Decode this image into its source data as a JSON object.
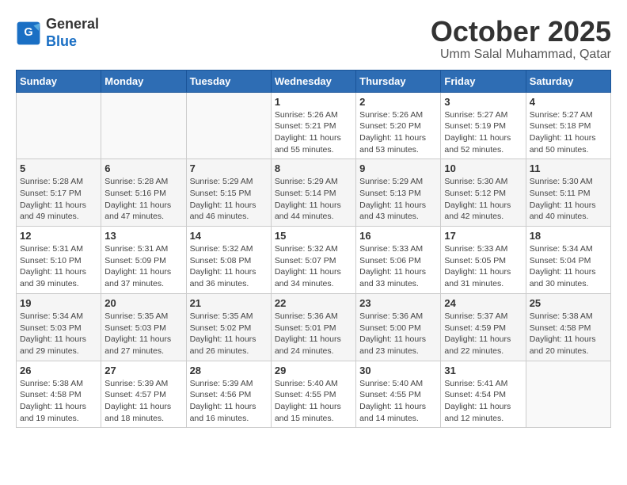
{
  "logo": {
    "general": "General",
    "blue": "Blue"
  },
  "title": "October 2025",
  "location": "Umm Salal Muhammad, Qatar",
  "days_of_week": [
    "Sunday",
    "Monday",
    "Tuesday",
    "Wednesday",
    "Thursday",
    "Friday",
    "Saturday"
  ],
  "weeks": [
    [
      {
        "day": "",
        "info": ""
      },
      {
        "day": "",
        "info": ""
      },
      {
        "day": "",
        "info": ""
      },
      {
        "day": "1",
        "info": "Sunrise: 5:26 AM\nSunset: 5:21 PM\nDaylight: 11 hours and 55 minutes."
      },
      {
        "day": "2",
        "info": "Sunrise: 5:26 AM\nSunset: 5:20 PM\nDaylight: 11 hours and 53 minutes."
      },
      {
        "day": "3",
        "info": "Sunrise: 5:27 AM\nSunset: 5:19 PM\nDaylight: 11 hours and 52 minutes."
      },
      {
        "day": "4",
        "info": "Sunrise: 5:27 AM\nSunset: 5:18 PM\nDaylight: 11 hours and 50 minutes."
      }
    ],
    [
      {
        "day": "5",
        "info": "Sunrise: 5:28 AM\nSunset: 5:17 PM\nDaylight: 11 hours and 49 minutes."
      },
      {
        "day": "6",
        "info": "Sunrise: 5:28 AM\nSunset: 5:16 PM\nDaylight: 11 hours and 47 minutes."
      },
      {
        "day": "7",
        "info": "Sunrise: 5:29 AM\nSunset: 5:15 PM\nDaylight: 11 hours and 46 minutes."
      },
      {
        "day": "8",
        "info": "Sunrise: 5:29 AM\nSunset: 5:14 PM\nDaylight: 11 hours and 44 minutes."
      },
      {
        "day": "9",
        "info": "Sunrise: 5:29 AM\nSunset: 5:13 PM\nDaylight: 11 hours and 43 minutes."
      },
      {
        "day": "10",
        "info": "Sunrise: 5:30 AM\nSunset: 5:12 PM\nDaylight: 11 hours and 42 minutes."
      },
      {
        "day": "11",
        "info": "Sunrise: 5:30 AM\nSunset: 5:11 PM\nDaylight: 11 hours and 40 minutes."
      }
    ],
    [
      {
        "day": "12",
        "info": "Sunrise: 5:31 AM\nSunset: 5:10 PM\nDaylight: 11 hours and 39 minutes."
      },
      {
        "day": "13",
        "info": "Sunrise: 5:31 AM\nSunset: 5:09 PM\nDaylight: 11 hours and 37 minutes."
      },
      {
        "day": "14",
        "info": "Sunrise: 5:32 AM\nSunset: 5:08 PM\nDaylight: 11 hours and 36 minutes."
      },
      {
        "day": "15",
        "info": "Sunrise: 5:32 AM\nSunset: 5:07 PM\nDaylight: 11 hours and 34 minutes."
      },
      {
        "day": "16",
        "info": "Sunrise: 5:33 AM\nSunset: 5:06 PM\nDaylight: 11 hours and 33 minutes."
      },
      {
        "day": "17",
        "info": "Sunrise: 5:33 AM\nSunset: 5:05 PM\nDaylight: 11 hours and 31 minutes."
      },
      {
        "day": "18",
        "info": "Sunrise: 5:34 AM\nSunset: 5:04 PM\nDaylight: 11 hours and 30 minutes."
      }
    ],
    [
      {
        "day": "19",
        "info": "Sunrise: 5:34 AM\nSunset: 5:03 PM\nDaylight: 11 hours and 29 minutes."
      },
      {
        "day": "20",
        "info": "Sunrise: 5:35 AM\nSunset: 5:03 PM\nDaylight: 11 hours and 27 minutes."
      },
      {
        "day": "21",
        "info": "Sunrise: 5:35 AM\nSunset: 5:02 PM\nDaylight: 11 hours and 26 minutes."
      },
      {
        "day": "22",
        "info": "Sunrise: 5:36 AM\nSunset: 5:01 PM\nDaylight: 11 hours and 24 minutes."
      },
      {
        "day": "23",
        "info": "Sunrise: 5:36 AM\nSunset: 5:00 PM\nDaylight: 11 hours and 23 minutes."
      },
      {
        "day": "24",
        "info": "Sunrise: 5:37 AM\nSunset: 4:59 PM\nDaylight: 11 hours and 22 minutes."
      },
      {
        "day": "25",
        "info": "Sunrise: 5:38 AM\nSunset: 4:58 PM\nDaylight: 11 hours and 20 minutes."
      }
    ],
    [
      {
        "day": "26",
        "info": "Sunrise: 5:38 AM\nSunset: 4:58 PM\nDaylight: 11 hours and 19 minutes."
      },
      {
        "day": "27",
        "info": "Sunrise: 5:39 AM\nSunset: 4:57 PM\nDaylight: 11 hours and 18 minutes."
      },
      {
        "day": "28",
        "info": "Sunrise: 5:39 AM\nSunset: 4:56 PM\nDaylight: 11 hours and 16 minutes."
      },
      {
        "day": "29",
        "info": "Sunrise: 5:40 AM\nSunset: 4:55 PM\nDaylight: 11 hours and 15 minutes."
      },
      {
        "day": "30",
        "info": "Sunrise: 5:40 AM\nSunset: 4:55 PM\nDaylight: 11 hours and 14 minutes."
      },
      {
        "day": "31",
        "info": "Sunrise: 5:41 AM\nSunset: 4:54 PM\nDaylight: 11 hours and 12 minutes."
      },
      {
        "day": "",
        "info": ""
      }
    ]
  ]
}
